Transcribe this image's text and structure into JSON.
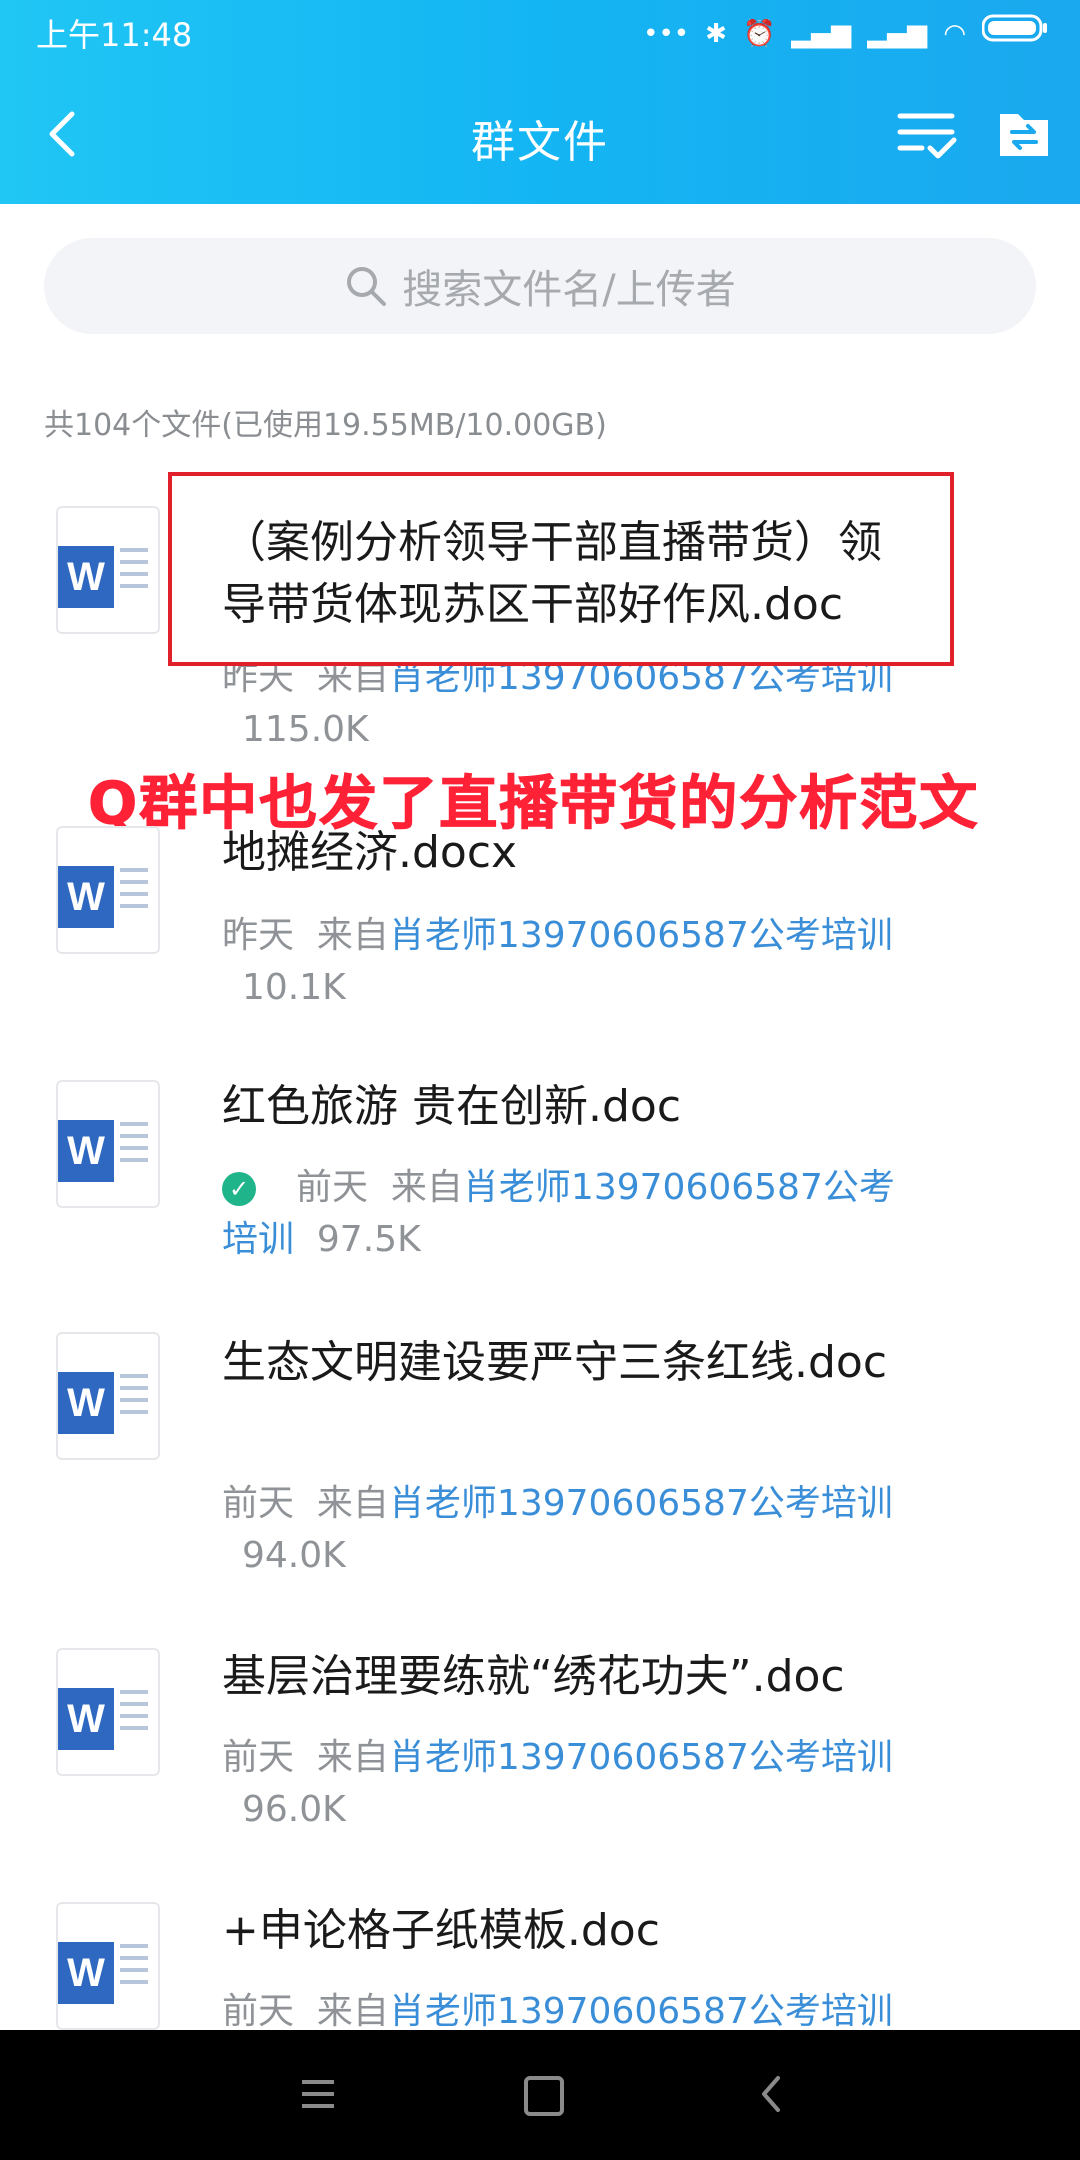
{
  "status_bar": {
    "time": "上午11:48",
    "battery_label": ""
  },
  "nav": {
    "title": "群文件"
  },
  "search": {
    "placeholder": "搜索文件名/上传者"
  },
  "summary": "共104个文件(已使用19.55MB/10.00GB)",
  "annotation": "Q群中也发了直播带货的分析范文",
  "files": [
    {
      "name": "（案例分析领导干部直播带货）领导带货体现苏区干部好作风.doc",
      "day": "昨天",
      "from_label": "来自",
      "uploader": "肖老师13970606587公考培训",
      "size": "115.0K"
    },
    {
      "name": "地摊经济.docx",
      "day": "昨天",
      "from_label": "来自",
      "uploader": "肖老师13970606587公考培训",
      "size": "10.1K"
    },
    {
      "name": "红色旅游 贵在创新.doc",
      "day": "前天",
      "from_label": "来自",
      "uploader": "肖老师13970606587公考培训",
      "size": "97.5K",
      "downloaded": true
    },
    {
      "name": "生态文明建设要严守三条红线.doc",
      "day": "前天",
      "from_label": "来自",
      "uploader": "肖老师13970606587公考培训",
      "size": "94.0K"
    },
    {
      "name": "基层治理要练就“绣花功夫”.doc",
      "day": "前天",
      "from_label": "来自",
      "uploader": "肖老师13970606587公考培训",
      "size": "96.0K"
    },
    {
      "name": "+申论格子纸模板.doc",
      "day": "前天",
      "from_label": "来自",
      "uploader": "肖老师13970606587公考培训",
      "size": ""
    }
  ],
  "icons": {
    "back": "chevron-left-icon",
    "multi_select": "list-check-icon",
    "transfer": "folder-transfer-icon",
    "search": "search-icon",
    "file": "word-doc-icon",
    "downloaded": "check-circle-icon"
  },
  "colors": {
    "header_start": "#20c6f4",
    "header_end": "#1aa8ee",
    "link": "#3a8ed8",
    "highlight": "#e0202a",
    "check": "#1fb48a"
  }
}
